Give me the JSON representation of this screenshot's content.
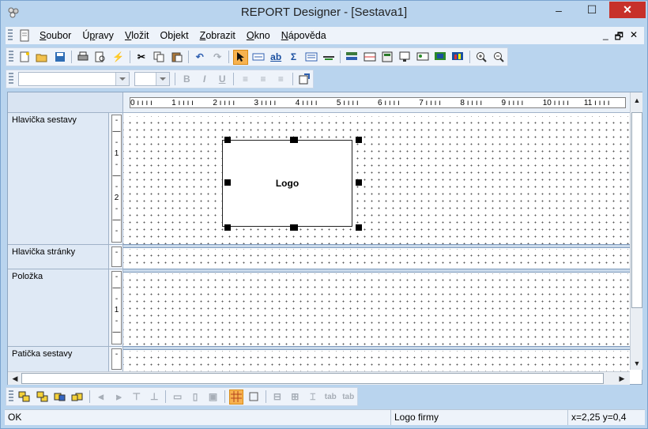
{
  "window": {
    "title": "REPORT Designer - [Sestava1]",
    "minimize": "–",
    "maximize": "☐",
    "close": "✕"
  },
  "menubar": {
    "items": [
      {
        "label": "Soubor",
        "accel": "S"
      },
      {
        "label": "Úpravy",
        "accel": "p"
      },
      {
        "label": "Vložit",
        "accel": "V"
      },
      {
        "label": "Objekt",
        "accel": "j"
      },
      {
        "label": "Zobrazit",
        "accel": "Z"
      },
      {
        "label": "Okno",
        "accel": "O"
      },
      {
        "label": "Nápověda",
        "accel": "N"
      }
    ],
    "mdi_controls": [
      "_",
      "🗗",
      "✕"
    ]
  },
  "toolbar_main": {
    "icons": [
      "new-icon",
      "open-icon",
      "save-icon",
      "print-icon",
      "preview-icon",
      "run-icon",
      "cut-icon",
      "copy-icon",
      "paste-icon",
      "undo-icon",
      "redo-icon",
      "pointer-icon",
      "label-icon",
      "text-field-icon",
      "sum-icon",
      "list-icon",
      "line-icon",
      "group-icon",
      "band-icon",
      "calc-icon",
      "property-icon",
      "image-icon",
      "barcode-icon",
      "chart-icon",
      "zoom-in-icon",
      "zoom-out-icon"
    ]
  },
  "toolbar_format": {
    "font_value": "",
    "size_value": "",
    "bold": "B",
    "italic": "I",
    "underline": "U"
  },
  "ruler": {
    "marks": [
      "0",
      "1",
      "2",
      "3",
      "4",
      "5",
      "6",
      "7",
      "8",
      "9",
      "10",
      "11"
    ]
  },
  "sections": [
    {
      "name": "Hlavička sestavy",
      "ruler": [
        "-",
        "—",
        "-",
        "1",
        "-",
        "—",
        "-",
        "2",
        "-",
        "—",
        "-"
      ]
    },
    {
      "name": "Hlavička stránky",
      "ruler": [
        "-"
      ]
    },
    {
      "name": "Položka",
      "ruler": [
        "-",
        "—",
        "-",
        "1",
        "-",
        "—"
      ]
    },
    {
      "name": "Patička sestavy",
      "ruler": [
        "-"
      ]
    }
  ],
  "logo_object": {
    "text": "Logo"
  },
  "status": {
    "message": "OK",
    "object": "Logo firmy",
    "coords": "x=2,25  y=0,4"
  }
}
